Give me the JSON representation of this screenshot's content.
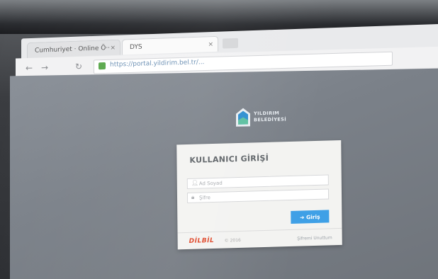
{
  "browser": {
    "tabs": [
      {
        "label": "Cumhuriyet · Online Ö··",
        "close": "×"
      },
      {
        "label": "DYS",
        "close": "×"
      }
    ],
    "url": "https://portal.yildirim.bel.tr/...",
    "lock_color": "#5aa84c"
  },
  "logo": {
    "line1": "YILDIRIM",
    "line2": "BELEDİYESİ"
  },
  "login": {
    "title": "KULLANICI GİRİŞİ",
    "username_placeholder": "Ad Soyad",
    "password_placeholder": "Şifre",
    "submit_label": "➜ Giriş",
    "accent": "#3fa0e6"
  },
  "footer": {
    "brand": "DİLBİL",
    "brand_sub": "© 2016",
    "forgot": "Şifremi Unuttum",
    "brand_color": "#e04a2c"
  }
}
